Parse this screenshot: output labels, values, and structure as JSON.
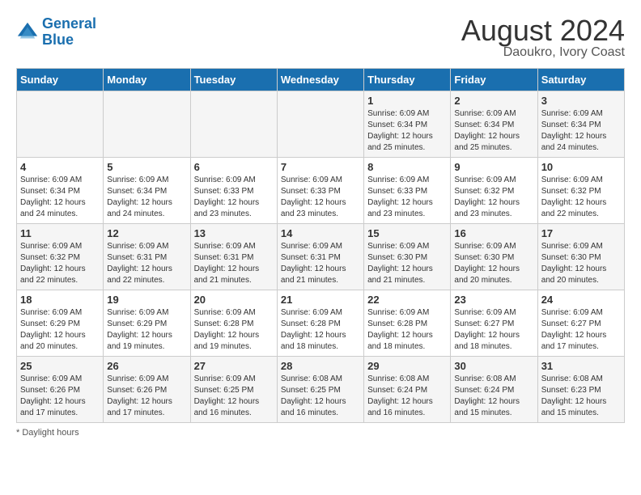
{
  "header": {
    "logo_line1": "General",
    "logo_line2": "Blue",
    "title": "August 2024",
    "subtitle": "Daoukro, Ivory Coast"
  },
  "days_of_week": [
    "Sunday",
    "Monday",
    "Tuesday",
    "Wednesday",
    "Thursday",
    "Friday",
    "Saturday"
  ],
  "footnote": "Daylight hours",
  "weeks": [
    [
      {
        "day": "",
        "info": ""
      },
      {
        "day": "",
        "info": ""
      },
      {
        "day": "",
        "info": ""
      },
      {
        "day": "",
        "info": ""
      },
      {
        "day": "1",
        "info": "Sunrise: 6:09 AM\nSunset: 6:34 PM\nDaylight: 12 hours\nand 25 minutes."
      },
      {
        "day": "2",
        "info": "Sunrise: 6:09 AM\nSunset: 6:34 PM\nDaylight: 12 hours\nand 25 minutes."
      },
      {
        "day": "3",
        "info": "Sunrise: 6:09 AM\nSunset: 6:34 PM\nDaylight: 12 hours\nand 24 minutes."
      }
    ],
    [
      {
        "day": "4",
        "info": "Sunrise: 6:09 AM\nSunset: 6:34 PM\nDaylight: 12 hours\nand 24 minutes."
      },
      {
        "day": "5",
        "info": "Sunrise: 6:09 AM\nSunset: 6:34 PM\nDaylight: 12 hours\nand 24 minutes."
      },
      {
        "day": "6",
        "info": "Sunrise: 6:09 AM\nSunset: 6:33 PM\nDaylight: 12 hours\nand 23 minutes."
      },
      {
        "day": "7",
        "info": "Sunrise: 6:09 AM\nSunset: 6:33 PM\nDaylight: 12 hours\nand 23 minutes."
      },
      {
        "day": "8",
        "info": "Sunrise: 6:09 AM\nSunset: 6:33 PM\nDaylight: 12 hours\nand 23 minutes."
      },
      {
        "day": "9",
        "info": "Sunrise: 6:09 AM\nSunset: 6:32 PM\nDaylight: 12 hours\nand 23 minutes."
      },
      {
        "day": "10",
        "info": "Sunrise: 6:09 AM\nSunset: 6:32 PM\nDaylight: 12 hours\nand 22 minutes."
      }
    ],
    [
      {
        "day": "11",
        "info": "Sunrise: 6:09 AM\nSunset: 6:32 PM\nDaylight: 12 hours\nand 22 minutes."
      },
      {
        "day": "12",
        "info": "Sunrise: 6:09 AM\nSunset: 6:31 PM\nDaylight: 12 hours\nand 22 minutes."
      },
      {
        "day": "13",
        "info": "Sunrise: 6:09 AM\nSunset: 6:31 PM\nDaylight: 12 hours\nand 21 minutes."
      },
      {
        "day": "14",
        "info": "Sunrise: 6:09 AM\nSunset: 6:31 PM\nDaylight: 12 hours\nand 21 minutes."
      },
      {
        "day": "15",
        "info": "Sunrise: 6:09 AM\nSunset: 6:30 PM\nDaylight: 12 hours\nand 21 minutes."
      },
      {
        "day": "16",
        "info": "Sunrise: 6:09 AM\nSunset: 6:30 PM\nDaylight: 12 hours\nand 20 minutes."
      },
      {
        "day": "17",
        "info": "Sunrise: 6:09 AM\nSunset: 6:30 PM\nDaylight: 12 hours\nand 20 minutes."
      }
    ],
    [
      {
        "day": "18",
        "info": "Sunrise: 6:09 AM\nSunset: 6:29 PM\nDaylight: 12 hours\nand 20 minutes."
      },
      {
        "day": "19",
        "info": "Sunrise: 6:09 AM\nSunset: 6:29 PM\nDaylight: 12 hours\nand 19 minutes."
      },
      {
        "day": "20",
        "info": "Sunrise: 6:09 AM\nSunset: 6:28 PM\nDaylight: 12 hours\nand 19 minutes."
      },
      {
        "day": "21",
        "info": "Sunrise: 6:09 AM\nSunset: 6:28 PM\nDaylight: 12 hours\nand 18 minutes."
      },
      {
        "day": "22",
        "info": "Sunrise: 6:09 AM\nSunset: 6:28 PM\nDaylight: 12 hours\nand 18 minutes."
      },
      {
        "day": "23",
        "info": "Sunrise: 6:09 AM\nSunset: 6:27 PM\nDaylight: 12 hours\nand 18 minutes."
      },
      {
        "day": "24",
        "info": "Sunrise: 6:09 AM\nSunset: 6:27 PM\nDaylight: 12 hours\nand 17 minutes."
      }
    ],
    [
      {
        "day": "25",
        "info": "Sunrise: 6:09 AM\nSunset: 6:26 PM\nDaylight: 12 hours\nand 17 minutes."
      },
      {
        "day": "26",
        "info": "Sunrise: 6:09 AM\nSunset: 6:26 PM\nDaylight: 12 hours\nand 17 minutes."
      },
      {
        "day": "27",
        "info": "Sunrise: 6:09 AM\nSunset: 6:25 PM\nDaylight: 12 hours\nand 16 minutes."
      },
      {
        "day": "28",
        "info": "Sunrise: 6:08 AM\nSunset: 6:25 PM\nDaylight: 12 hours\nand 16 minutes."
      },
      {
        "day": "29",
        "info": "Sunrise: 6:08 AM\nSunset: 6:24 PM\nDaylight: 12 hours\nand 16 minutes."
      },
      {
        "day": "30",
        "info": "Sunrise: 6:08 AM\nSunset: 6:24 PM\nDaylight: 12 hours\nand 15 minutes."
      },
      {
        "day": "31",
        "info": "Sunrise: 6:08 AM\nSunset: 6:23 PM\nDaylight: 12 hours\nand 15 minutes."
      }
    ]
  ]
}
